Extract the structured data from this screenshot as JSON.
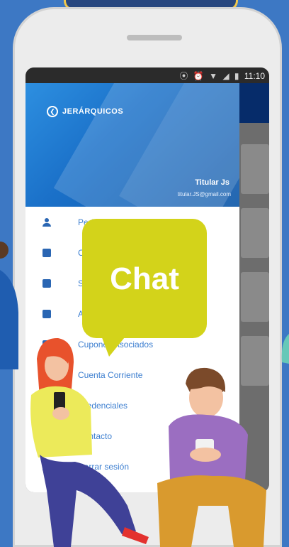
{
  "status_bar": {
    "time": "11:10",
    "icons": "⦿ ⏰ ▼ ◢ ▮"
  },
  "drawer": {
    "back_label": "JERÁRQUICOS",
    "user_name": "Titular Js",
    "user_email": "titular.JS@gmail.com",
    "menu_items": [
      {
        "label": "Perfil",
        "icon": "person-icon"
      },
      {
        "label": "C",
        "icon": "badge-icon"
      },
      {
        "label": "S",
        "icon": "plus-square-icon"
      },
      {
        "label": "A",
        "icon": "document-icon"
      },
      {
        "label": "Cupones Asociados",
        "icon": "coupon-icon"
      },
      {
        "label": "Cuenta Corriente",
        "icon": "account-icon"
      },
      {
        "label": "Credenciales",
        "icon": "credential-icon"
      },
      {
        "label": "Contacto",
        "icon": "contact-icon"
      },
      {
        "label": "Cerrar sesión",
        "icon": "logout-icon"
      }
    ]
  },
  "chat_bubble": {
    "label": "Chat"
  },
  "colors": {
    "background": "#3d78c4",
    "chat": "#d3d31a",
    "header": "#1b71c9",
    "accent_text": "#3d7fd0"
  }
}
